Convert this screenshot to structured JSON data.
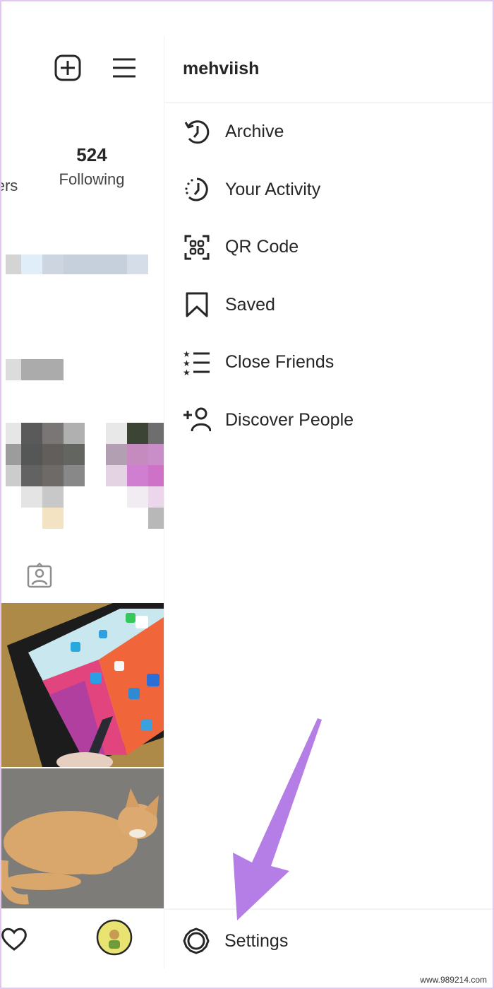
{
  "profile": {
    "following_count": "524",
    "following_label": "Following",
    "followers_label_partial": "ers"
  },
  "drawer": {
    "username": "mehviish",
    "items": [
      {
        "label": "Archive",
        "icon": "archive-icon"
      },
      {
        "label": "Your Activity",
        "icon": "activity-icon"
      },
      {
        "label": "QR Code",
        "icon": "qr-code-icon"
      },
      {
        "label": "Saved",
        "icon": "bookmark-icon"
      },
      {
        "label": "Close Friends",
        "icon": "close-friends-icon"
      },
      {
        "label": "Discover People",
        "icon": "add-person-icon"
      }
    ],
    "settings_label": "Settings"
  },
  "annotation": {
    "arrow_color": "#b57ee6"
  },
  "watermark": "www.989214.com"
}
